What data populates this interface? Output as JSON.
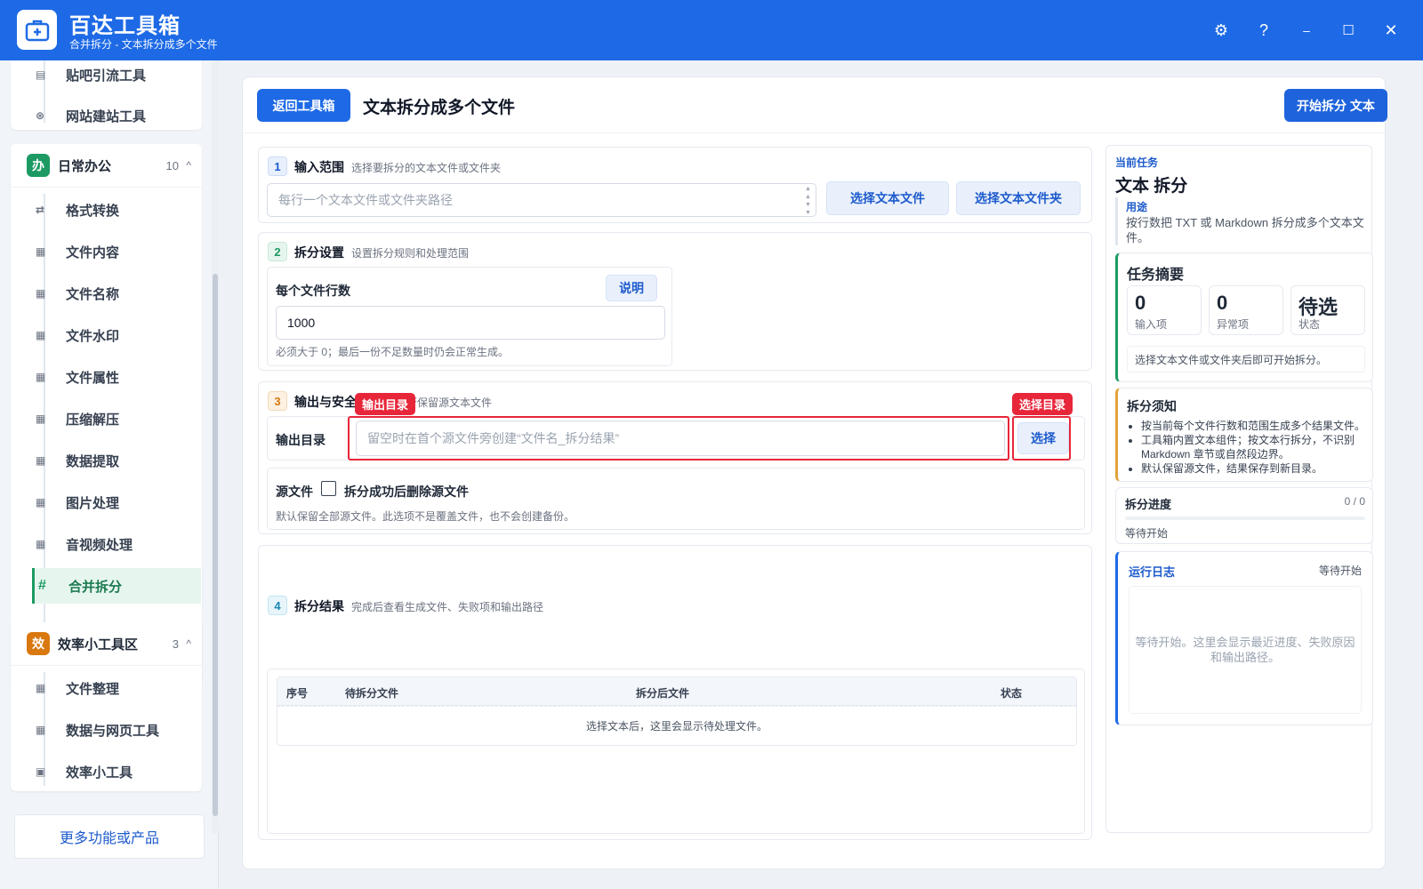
{
  "app": {
    "title": "百达工具箱",
    "subtitle": "合并拆分 - 文本拆分成多个文件"
  },
  "window_controls": {
    "settings": "⚙",
    "help": "?",
    "minimize": "–",
    "maximize": "☐",
    "close": "✕"
  },
  "sidebar": {
    "top_items": [
      {
        "label": "贴吧引流工具",
        "icon": "document-icon"
      },
      {
        "label": "网站建站工具",
        "icon": "globe-icon"
      }
    ],
    "group_office": {
      "badge": "办",
      "title": "日常办公",
      "count": "10",
      "caret": "^",
      "color": "#1d9a63",
      "items": [
        {
          "label": "格式转换",
          "icon": "⇄"
        },
        {
          "label": "文件内容",
          "icon": "▦"
        },
        {
          "label": "文件名称",
          "icon": "▦"
        },
        {
          "label": "文件水印",
          "icon": "▦"
        },
        {
          "label": "文件属性",
          "icon": "▦"
        },
        {
          "label": "压缩解压",
          "icon": "▦"
        },
        {
          "label": "数据提取",
          "icon": "▦"
        },
        {
          "label": "图片处理",
          "icon": "▦"
        },
        {
          "label": "音视频处理",
          "icon": "▦"
        },
        {
          "label": "合并拆分",
          "icon": "#"
        }
      ]
    },
    "group_efficiency": {
      "badge": "效",
      "title": "效率小工具区",
      "count": "3",
      "caret": "^",
      "color": "#d9780f",
      "items": [
        {
          "label": "文件整理",
          "icon": "▦"
        },
        {
          "label": "数据与网页工具",
          "icon": "▦"
        },
        {
          "label": "效率小工具",
          "icon": "▣"
        }
      ]
    },
    "more": "更多功能或产品"
  },
  "main": {
    "back_button": "返回工具箱",
    "title": "文本拆分成多个文件",
    "start_button": "开始拆分 文本",
    "s1": {
      "num": "1",
      "title": "输入范围",
      "desc": "选择要拆分的文本文件或文件夹",
      "placeholder": "每行一个文本文件或文件夹路径",
      "btn_file": "选择文本文件",
      "btn_folder": "选择文本文件夹"
    },
    "s2": {
      "num": "2",
      "title": "拆分设置",
      "desc": "设置拆分规则和处理范围",
      "field_label": "每个文件行数",
      "help_button": "说明",
      "value": "1000",
      "hint": "必须大于 0；最后一份不足数量时仍会正常生成。"
    },
    "s3": {
      "num": "3",
      "title": "输出与安全",
      "desc": "置以及是否保留源文本文件",
      "output_label": "输出目录",
      "output_placeholder": "留空时在首个源文件旁创建“文件名_拆分结果”",
      "choose_button": "选择",
      "tag_output": "输出目录",
      "tag_choose": "选择目录",
      "source_label": "源文件",
      "checkbox_label": "拆分成功后删除源文件",
      "source_hint": "默认保留全部源文件。此选项不是覆盖文件，也不会创建备份。"
    },
    "s4": {
      "num": "4",
      "title": "拆分结果",
      "desc": "完成后查看生成文件、失败项和输出路径",
      "columns": [
        "序号",
        "待拆分文件",
        "拆分后文件",
        "状态"
      ],
      "empty": "选择文本后，这里会显示待处理文件。"
    }
  },
  "side": {
    "current_label": "当前任务",
    "task_title": "文本 拆分",
    "usage_label": "用途",
    "usage_text": "按行数把 TXT 或 Markdown 拆分成多个文本文件。",
    "summary": {
      "title": "任务摘要",
      "stats": [
        {
          "value": "0",
          "label": "输入项"
        },
        {
          "value": "0",
          "label": "异常项"
        },
        {
          "value": "待选",
          "label": "状态"
        }
      ],
      "hint": "选择文本文件或文件夹后即可开始拆分。"
    },
    "notice": {
      "title": "拆分须知",
      "items": [
        "按当前每个文件行数和范围生成多个结果文件。",
        "工具箱内置文本组件；按文本行拆分，不识别 Markdown 章节或自然段边界。",
        "默认保留源文件，结果保存到新目录。"
      ]
    },
    "progress": {
      "title": "拆分进度",
      "count": "0 / 0",
      "status": "等待开始",
      "value": 0
    },
    "log": {
      "title": "运行日志",
      "status": "等待开始",
      "placeholder": "等待开始。这里会显示最近进度、失败原因和输出路径。"
    }
  }
}
